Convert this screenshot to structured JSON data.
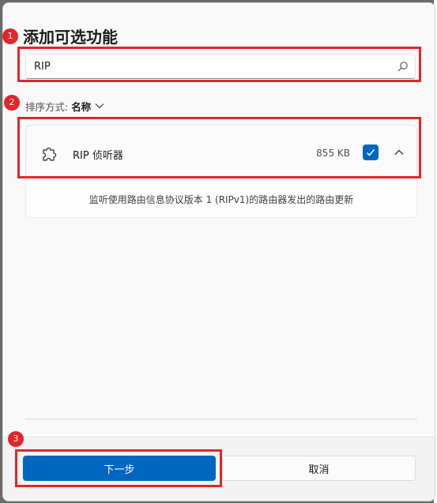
{
  "dialog": {
    "title": "添加可选功能",
    "search": {
      "value": "RIP",
      "placeholder": ""
    },
    "sort": {
      "label": "排序方式:",
      "value": "名称"
    },
    "feature": {
      "name": "RIP 侦听器",
      "size": "855 KB",
      "checked": true,
      "description": "监听使用路由信息协议版本 1 (RIPv1)的路由器发出的路由更新"
    },
    "buttons": {
      "next": "下一步",
      "cancel": "取消"
    }
  },
  "annotations": [
    {
      "number": "1"
    },
    {
      "number": "2"
    },
    {
      "number": "3"
    }
  ],
  "colors": {
    "accent": "#0067c0",
    "annotation": "#e2262a"
  },
  "icons": [
    "search-icon",
    "puzzle-piece-icon",
    "checkmark-icon",
    "chevron-down-icon",
    "chevron-up-icon",
    "scroll-left-icon"
  ]
}
